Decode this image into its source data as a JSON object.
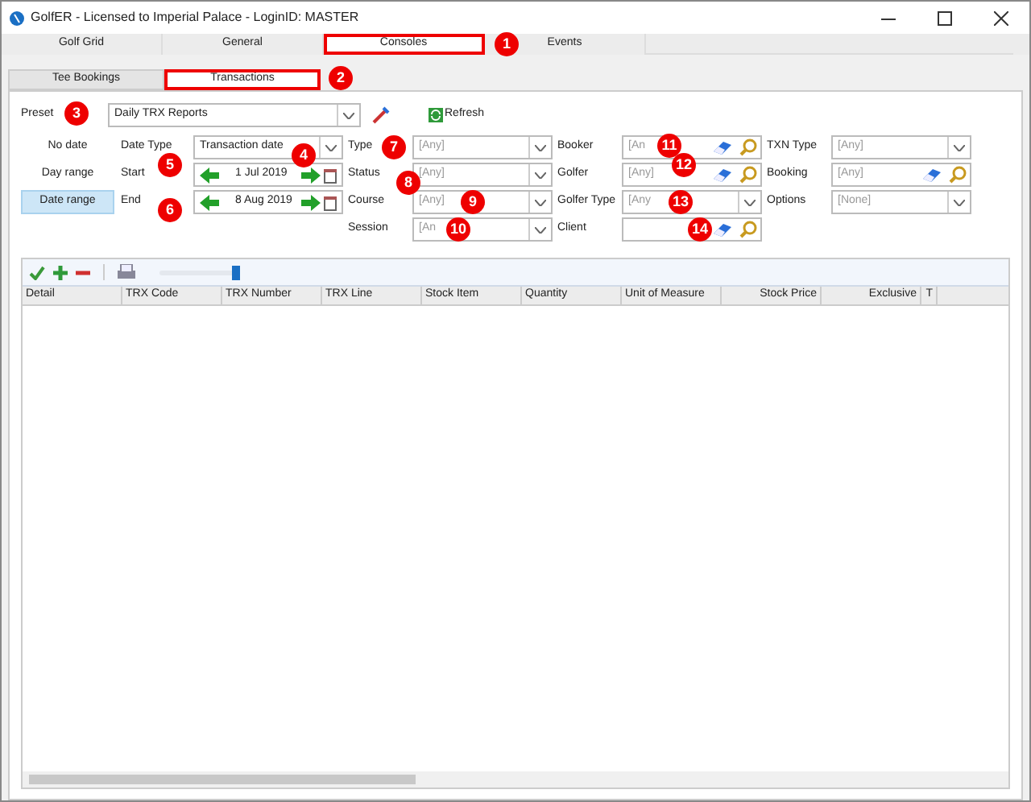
{
  "window": {
    "title": "GolfER - Licensed to Imperial Palace - LoginID: MASTER"
  },
  "main_tabs": [
    {
      "label": "Golf Grid",
      "selected": false
    },
    {
      "label": "General",
      "selected": false
    },
    {
      "label": "Consoles",
      "selected": true
    },
    {
      "label": "Events",
      "selected": false
    }
  ],
  "sub_tabs": [
    {
      "label": "Tee Bookings",
      "selected": false
    },
    {
      "label": "Transactions",
      "selected": true
    }
  ],
  "preset": {
    "label": "Preset",
    "value": "Daily TRX Reports",
    "refresh": "Refresh"
  },
  "date_modes": [
    {
      "label": "No date",
      "selected": false
    },
    {
      "label": "Day range",
      "selected": false
    },
    {
      "label": "Date range",
      "selected": true
    }
  ],
  "date_fields": [
    {
      "label": "Date Type",
      "kind": "combo",
      "value": "Transaction date"
    },
    {
      "label": "Start",
      "kind": "date",
      "value": "1 Jul 2019"
    },
    {
      "label": "End",
      "kind": "date",
      "value": "8 Aug 2019"
    }
  ],
  "filter_columns": [
    [
      {
        "label": "Type",
        "kind": "combo",
        "placeholder": "[Any]"
      },
      {
        "label": "Status",
        "kind": "combo",
        "placeholder": "[Any]"
      },
      {
        "label": "Course",
        "kind": "combo",
        "placeholder": "[Any]"
      },
      {
        "label": "Session",
        "kind": "combo",
        "placeholder": "[An"
      }
    ],
    [
      {
        "label": "Booker",
        "kind": "lookup",
        "placeholder": "[An"
      },
      {
        "label": "Golfer",
        "kind": "lookup",
        "placeholder": "[Any]"
      },
      {
        "label": "Golfer Type",
        "kind": "combo",
        "placeholder": "[Any"
      },
      {
        "label": "Client",
        "kind": "lookup"
      }
    ],
    [
      {
        "label": "TXN Type",
        "kind": "combo",
        "placeholder": "[Any]"
      },
      {
        "label": "Booking",
        "kind": "lookup",
        "placeholder": "[Any]"
      },
      {
        "label": "Options",
        "kind": "combo",
        "placeholder": "[None]"
      }
    ]
  ],
  "toolbar": {
    "zoom_slider": {
      "level": 1
    }
  },
  "table": {
    "columns": [
      "Detail",
      "TRX Code",
      "TRX Number",
      "TRX Line",
      "Stock Item",
      "Quantity",
      "Unit of Measure",
      "Stock Price",
      "Exclusive",
      "T"
    ]
  },
  "callouts": [
    "1",
    "2",
    "3",
    "5",
    "4",
    "6",
    "7",
    "8",
    "9",
    "10",
    "11",
    "12",
    "13",
    "14"
  ]
}
